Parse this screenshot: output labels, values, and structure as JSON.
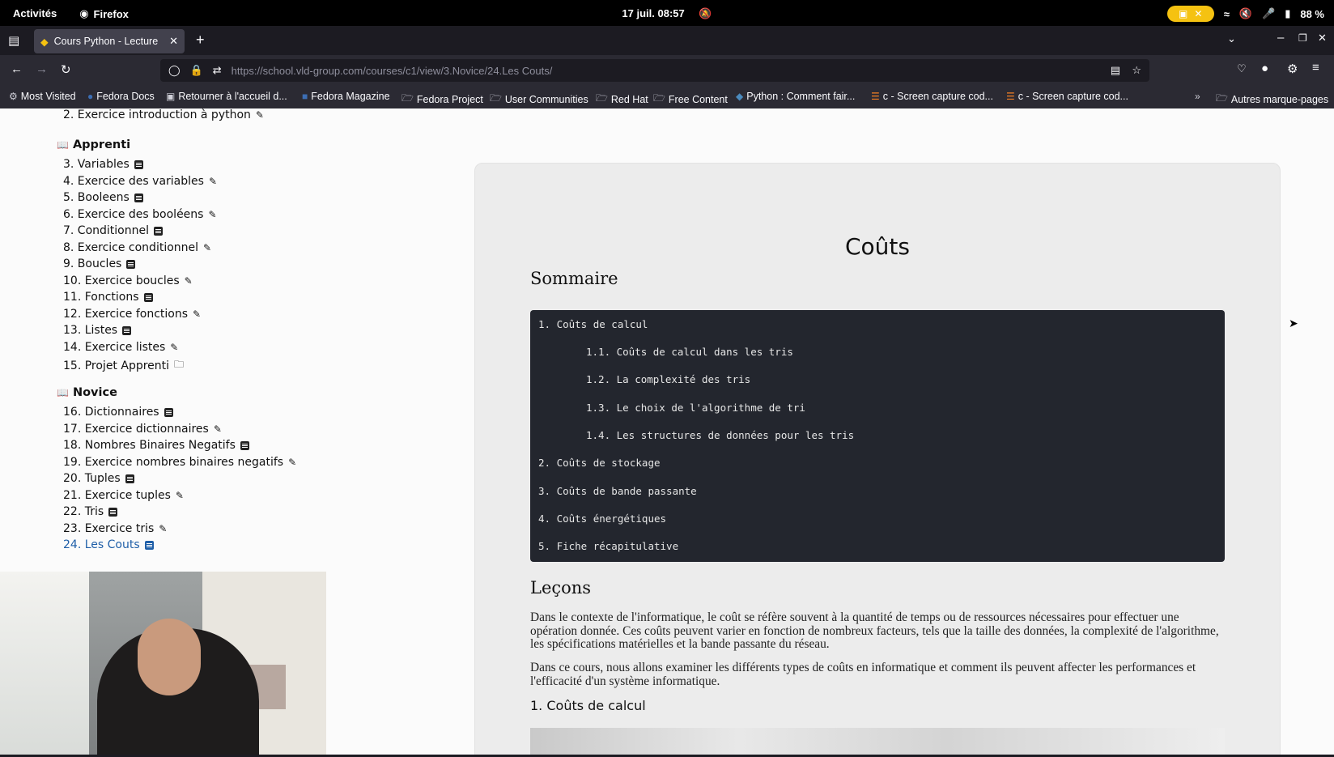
{
  "topbar": {
    "activities": "Activités",
    "app_name": "Firefox",
    "clock": "17 juil.  08:57",
    "battery": "88 %"
  },
  "browser": {
    "tab_title": "Cours Python - Lecture",
    "url": "https://school.vld-group.com/courses/c1/view/3.Novice/24.Les Couts/",
    "bookmarks": [
      "Most Visited",
      "Fedora Docs",
      "Retourner à l'accueil d...",
      "Fedora Magazine",
      "Fedora Project",
      "User Communities",
      "Red Hat",
      "Free Content",
      "Python : Comment fair...",
      "c - Screen capture cod...",
      "c - Screen capture cod...",
      "Autres marque-pages"
    ]
  },
  "sidebar": {
    "top_item": "2. Exercice introduction à python",
    "sections": [
      {
        "title": "Apprenti",
        "items": [
          {
            "label": "3. Variables",
            "kind": "lesson"
          },
          {
            "label": "4. Exercice des variables",
            "kind": "exercise"
          },
          {
            "label": "5. Booleens",
            "kind": "lesson"
          },
          {
            "label": "6. Exercice des booléens",
            "kind": "exercise"
          },
          {
            "label": "7. Conditionnel",
            "kind": "lesson"
          },
          {
            "label": "8. Exercice conditionnel",
            "kind": "exercise"
          },
          {
            "label": "9. Boucles",
            "kind": "lesson"
          },
          {
            "label": "10. Exercice boucles",
            "kind": "exercise"
          },
          {
            "label": "11. Fonctions",
            "kind": "lesson"
          },
          {
            "label": "12. Exercice fonctions",
            "kind": "exercise"
          },
          {
            "label": "13. Listes",
            "kind": "lesson"
          },
          {
            "label": "14. Exercice listes",
            "kind": "exercise"
          },
          {
            "label": "15. Projet Apprenti",
            "kind": "project"
          }
        ]
      },
      {
        "title": "Novice",
        "items": [
          {
            "label": "16. Dictionnaires",
            "kind": "lesson"
          },
          {
            "label": "17. Exercice dictionnaires",
            "kind": "exercise"
          },
          {
            "label": "18. Nombres Binaires Negatifs",
            "kind": "lesson"
          },
          {
            "label": "19. Exercice nombres binaires negatifs",
            "kind": "exercise"
          },
          {
            "label": "20. Tuples",
            "kind": "lesson"
          },
          {
            "label": "21. Exercice tuples",
            "kind": "exercise"
          },
          {
            "label": "22. Tris",
            "kind": "lesson"
          },
          {
            "label": "23. Exercice tris",
            "kind": "exercise"
          },
          {
            "label": "24. Les Couts",
            "kind": "lesson",
            "active": true
          }
        ]
      }
    ]
  },
  "content": {
    "title": "Coûts",
    "sommaire_heading": "Sommaire",
    "toc": [
      "1. Coûts de calcul",
      "1.1. Coûts de calcul dans les tris",
      "1.2. La complexité des tris",
      "1.3. Le choix de l'algorithme de tri",
      "1.4. Les structures de données pour les tris",
      "2. Coûts de stockage",
      "3. Coûts de bande passante",
      "4. Coûts énergétiques",
      "5. Fiche récapitulative"
    ],
    "lecons_heading": "Leçons",
    "para1": "Dans le contexte de l'informatique, le coût se réfère souvent à la quantité de temps ou de ressources nécessaires pour effectuer une opération donnée. Ces coûts peuvent varier en fonction de nombreux facteurs, tels que la taille des données, la complexité de l'algorithme, les spécifications matérielles et la bande passante du réseau.",
    "para2": "Dans ce cours, nous allons examiner les différents types de coûts en informatique et comment ils peuvent affecter les performances et l'efficacité d'un système informatique.",
    "subheading": "1. Coûts de calcul"
  },
  "colors": {
    "active_link": "#1f5fa8",
    "toc_bg": "#23262e",
    "battery_pill": "#f5c211"
  }
}
